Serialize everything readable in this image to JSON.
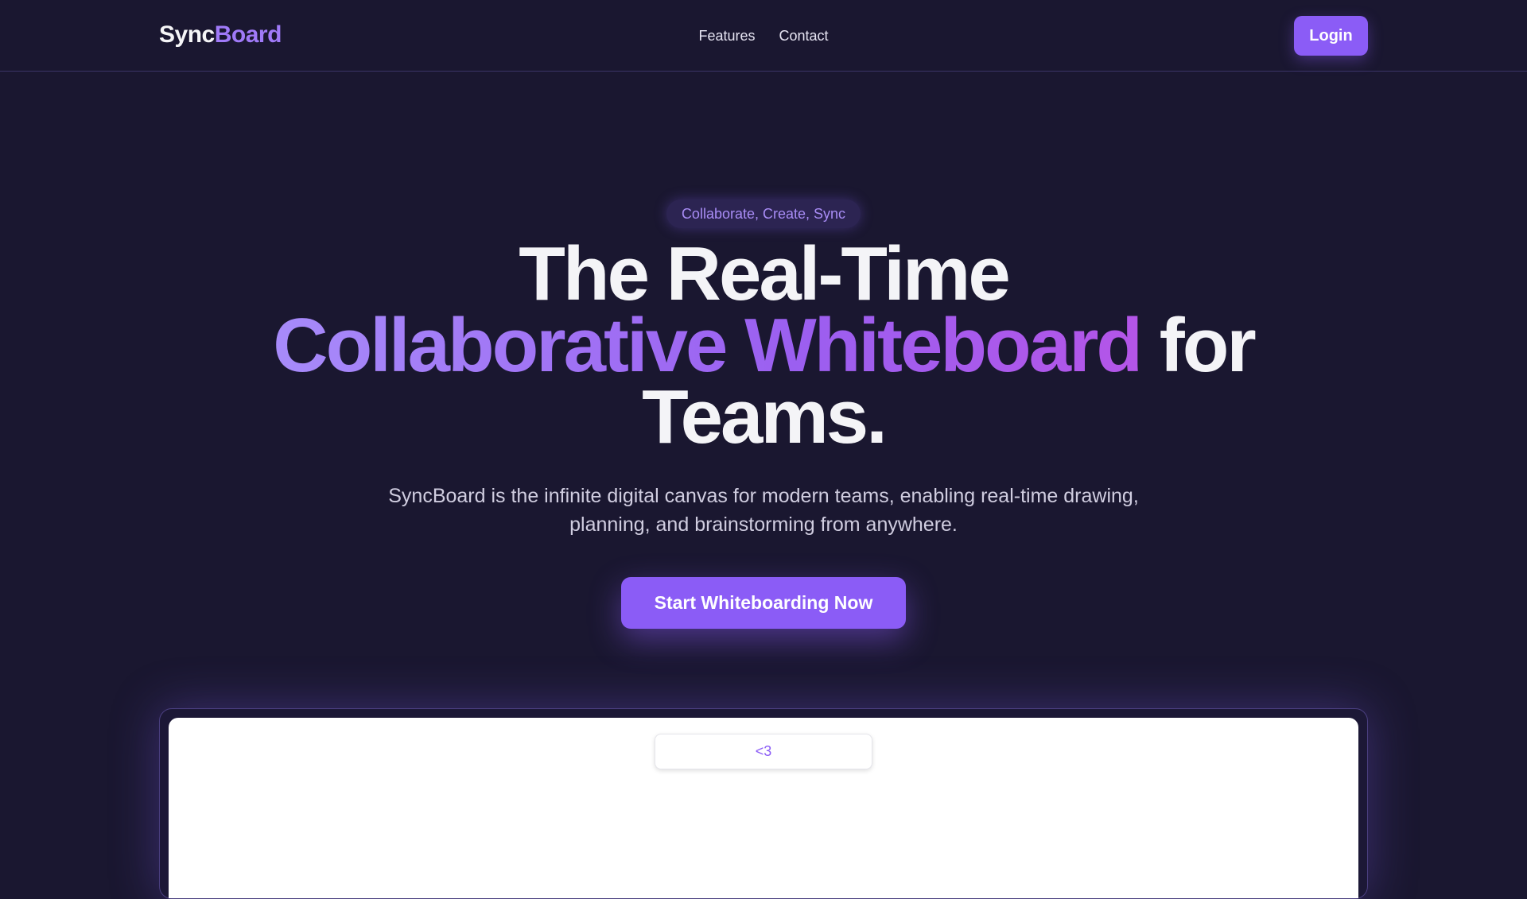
{
  "navbar": {
    "logo_main": "Sync",
    "logo_accent": "Board",
    "links": [
      "Features",
      "Contact"
    ],
    "login_label": "Login"
  },
  "hero": {
    "badge": "Collaborate, Create, Sync",
    "headline_line1": "The Real-Time",
    "headline_gradient": "Collaborative Whiteboard",
    "headline_line2_rest": " for",
    "headline_line3": "Teams.",
    "subtitle": "SyncBoard is the infinite digital canvas for modern teams, enabling real-time drawing, planning, and brainstorming from anywhere.",
    "cta_label": "Start Whiteboarding Now"
  },
  "preview": {
    "canvas_input_text": "<3"
  },
  "colors": {
    "background": "#1a1730",
    "accent": "#8b5cf6",
    "accent_light": "#a07af8",
    "text": "#f4f4f7"
  }
}
